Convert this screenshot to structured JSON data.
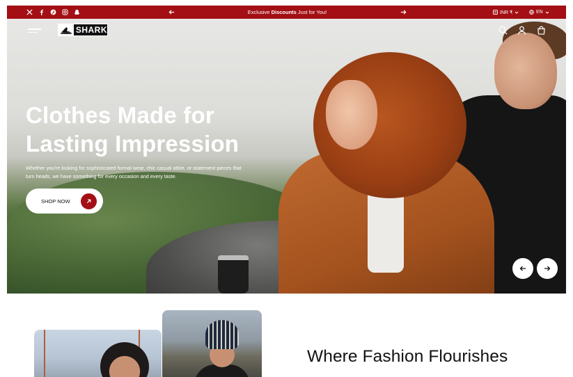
{
  "topbar": {
    "social_icons": [
      "x-icon",
      "facebook-icon",
      "pinterest-icon",
      "instagram-icon",
      "snapchat-icon"
    ],
    "promo_prefix": "Exclusive",
    "promo_bold": "Discounts",
    "promo_suffix": "Just for You!",
    "currency": "INR ₹",
    "language": "EN",
    "background": "#a30f14"
  },
  "header": {
    "logo_text": "SHARK",
    "icons": [
      "menu-icon",
      "search-icon",
      "account-icon",
      "cart-icon"
    ]
  },
  "hero": {
    "headline_line1": "Clothes Made for",
    "headline_line2": "Lasting Impression",
    "subcopy": "Whether you're looking for sophisticated formal wear, chic casual attire, or statement pieces that turn heads, we have something for every occasion and every taste.",
    "cta_label": "SHOP NOW",
    "accent": "#a30f14"
  },
  "section": {
    "title": "Where Fashion Flourishes"
  }
}
